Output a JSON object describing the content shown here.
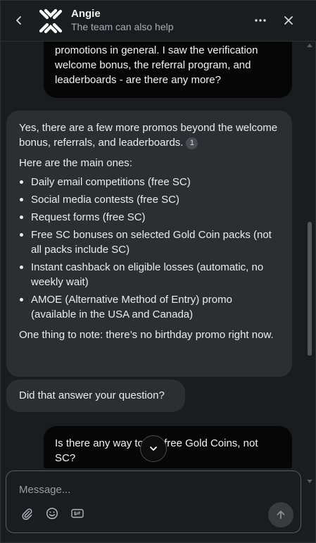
{
  "header": {
    "agent_name": "Angie",
    "subtitle": "The team can also help"
  },
  "icons": {
    "back": "chevron-left-icon",
    "logo": "brand-logo",
    "more": "more-horizontal-icon",
    "close": "close-icon",
    "scroll_down": "chevron-down-icon",
    "attach": "paperclip-icon",
    "emoji": "emoji-icon",
    "gif": "gif-icon",
    "send": "arrow-up-icon"
  },
  "messages": {
    "user_1": {
      "text": "promotions in general. I saw the verification welcome bonus, the referral program, and leaderboards - are there any more?"
    },
    "agent_1": {
      "intro": "Yes, there are a few more promos beyond the welcome bonus, referrals, and leaderboards.",
      "citation": "1",
      "lead": "Here are the main ones:",
      "items": [
        "Daily email competitions (free SC)",
        "Social media contests (free SC)",
        "Request forms (free SC)",
        "Free SC bonuses on selected Gold Coin packs (not all packs include SC)",
        "Instant cashback on eligible losses (automatic, no weekly wait)",
        "AMOE (Alternative Method of Entry) promo (available in the USA and Canada)"
      ],
      "note": "One thing to note: there’s no birthday promo right now."
    },
    "agent_2": {
      "text": "Did that answer your question?"
    },
    "user_2": {
      "text": "Is there any way to get free Gold Coins, not SC?"
    }
  },
  "composer": {
    "placeholder": "Message..."
  },
  "colors": {
    "background": "#1b1c1f",
    "agent_bubble": "#2d2e32",
    "user_bubble": "#060606",
    "text": "#ececec",
    "muted_text": "#a9abb0"
  }
}
